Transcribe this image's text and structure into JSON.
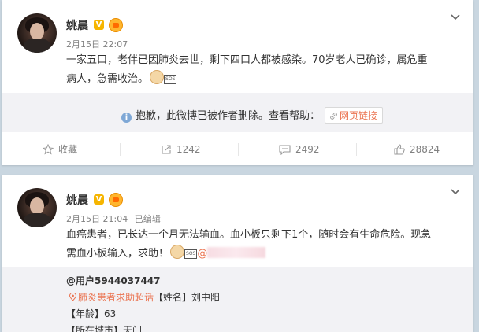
{
  "post1": {
    "author": "姚晨",
    "verified_badge": "V",
    "date": "2月15日 22:07",
    "text_line1": "一家五口，老伴已因肺炎去世，剩下四口人都被感染。70岁老人已确诊，属危重",
    "text_line2": "病人，急需收治。",
    "emoji_sos": "SOS",
    "deleted_notice": "抱歉，此微博已被作者删除。查看帮助：",
    "link_label": "网页链接",
    "actions": {
      "favorite": "收藏",
      "repost": "1242",
      "comment": "2492",
      "like": "28824"
    }
  },
  "post2": {
    "author": "姚晨",
    "verified_badge": "V",
    "date": "2月15日 21:04",
    "edited": "已编辑",
    "text_line1": "血癌患者，已长达一个月无法输血。血小板只剩下1个，随时会有生命危险。现急",
    "text_line2": "需血小板输入，求助！",
    "emoji_sos": "SOS",
    "mention_at": "@",
    "quoted": {
      "user": "@用户5944037447",
      "supertopic": "肺炎患者求助超话",
      "name_field": "【姓名】刘中阳",
      "age_field": "【年龄】63",
      "city_field": "【所在城市】天门"
    }
  }
}
